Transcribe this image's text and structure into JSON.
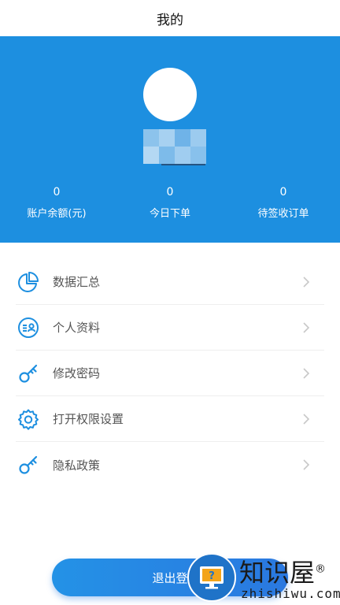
{
  "header": {
    "title": "我的"
  },
  "profile": {
    "username_obscured": true
  },
  "stats": [
    {
      "value": "0",
      "label": "账户余额(元)"
    },
    {
      "value": "0",
      "label": "今日下单"
    },
    {
      "value": "0",
      "label": "待签收订单"
    }
  ],
  "menu": [
    {
      "label": "数据汇总",
      "icon": "pie-chart-icon"
    },
    {
      "label": "个人资料",
      "icon": "profile-card-icon"
    },
    {
      "label": "修改密码",
      "icon": "key-icon"
    },
    {
      "label": "打开权限设置",
      "icon": "gear-icon"
    },
    {
      "label": "隐私政策",
      "icon": "key-icon"
    }
  ],
  "logout": {
    "label": "退出登"
  },
  "watermark": {
    "title": "知识屋",
    "registered": "®",
    "site": "zhishiwu.com"
  },
  "colors": {
    "primary": "#1d8fe0",
    "icon": "#1d8fe0",
    "chevron": "#c8c8c8"
  }
}
